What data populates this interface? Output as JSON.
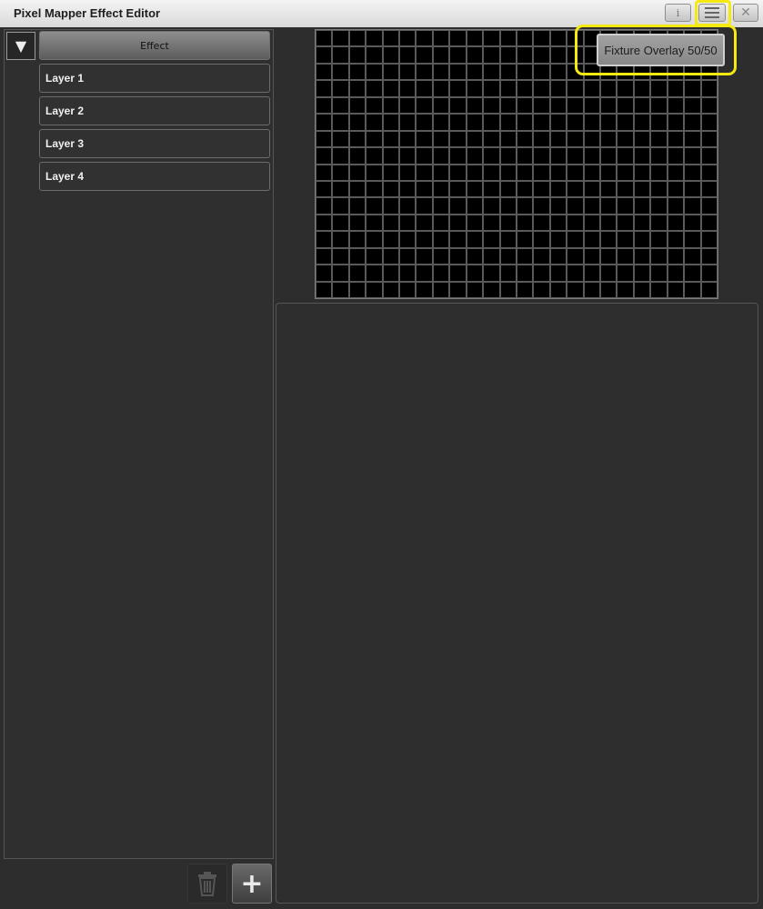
{
  "window": {
    "title": "Pixel Mapper Effect Editor",
    "buttons": {
      "info": "i",
      "close": "✕"
    },
    "highlight_color": "#f5ea10"
  },
  "tree": {
    "collapse_glyph": "▼",
    "effect_label": "Effect",
    "layers": [
      {
        "label": "Layer 1"
      },
      {
        "label": "Layer 2"
      },
      {
        "label": "Layer 3"
      },
      {
        "label": "Layer 4"
      }
    ]
  },
  "toolbar": {
    "add_glyph": "+",
    "delete_icon": "trash-icon"
  },
  "preview": {
    "overlay_button_label": "Fixture Overlay 50/50",
    "grid_columns": 24,
    "grid_rows": 16
  }
}
